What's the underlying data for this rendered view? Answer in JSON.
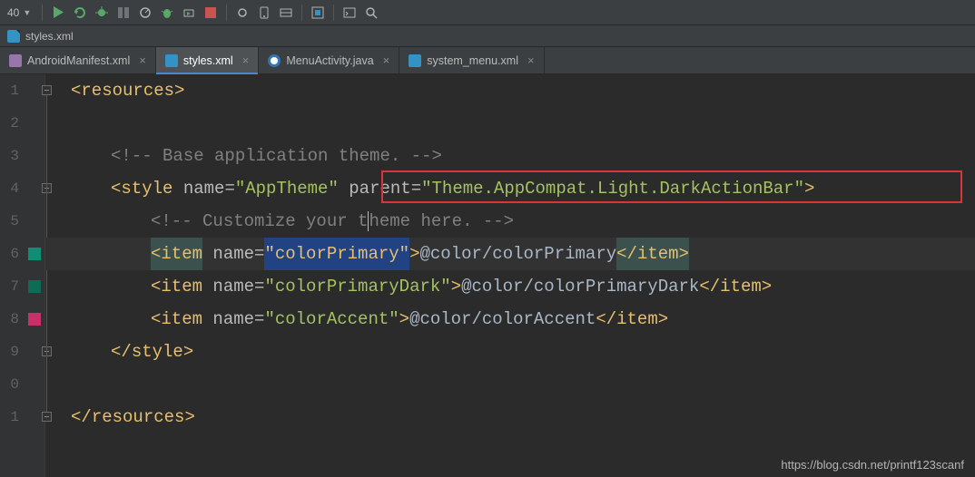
{
  "toolbar": {
    "run_config": "40",
    "icons": [
      "dropdown",
      "run",
      "debug",
      "coverage",
      "bug",
      "rerun",
      "profile",
      "stop",
      "attach",
      "layout1",
      "layout2",
      "settings",
      "device",
      "search"
    ]
  },
  "breadcrumb": {
    "file": "styles.xml"
  },
  "tabs": [
    {
      "label": "AndroidManifest.xml",
      "icon": "xml",
      "active": false
    },
    {
      "label": "styles.xml",
      "icon": "xml",
      "active": true
    },
    {
      "label": "MenuActivity.java",
      "icon": "java",
      "active": false
    },
    {
      "label": "system_menu.xml",
      "icon": "xml",
      "active": false
    }
  ],
  "gutter": {
    "lines": [
      "1",
      "2",
      "3",
      "4",
      "5",
      "6",
      "7",
      "8",
      "9",
      "0",
      "1"
    ],
    "squares": [
      {
        "line": 6,
        "color": "#0e8f73"
      },
      {
        "line": 7,
        "color": "#0e6b55"
      },
      {
        "line": 8,
        "color": "#c9306a"
      }
    ],
    "bulb_line": 6
  },
  "code": {
    "l1": {
      "open": "<",
      "tag": "resources",
      "close": ">"
    },
    "l3": {
      "comment": "<!-- Base application theme. -->"
    },
    "l4": {
      "open": "<",
      "tag": "style",
      "a1": "name",
      "v1": "\"AppTheme\"",
      "a2": "parent",
      "v2": "\"Theme.AppCompat.Light.DarkActionBar\"",
      "close": ">"
    },
    "l5": {
      "comment": "<!-- Customize your theme here. -->"
    },
    "l6": {
      "open": "<",
      "tag": "item",
      "a1": "name",
      "v1": "\"colorPrimary\"",
      "mid": ">",
      "text": "@color/colorPrimary",
      "end_open": "</",
      "end_tag": "item",
      "end_close": ">"
    },
    "l7": {
      "open": "<",
      "tag": "item",
      "a1": "name",
      "v1": "\"colorPrimaryDark\"",
      "mid": ">",
      "text": "@color/colorPrimaryDark",
      "end_open": "</",
      "end_tag": "item",
      "end_close": ">"
    },
    "l8": {
      "open": "<",
      "tag": "item",
      "a1": "name",
      "v1": "\"colorAccent\"",
      "mid": ">",
      "text": "@color/colorAccent",
      "end_open": "</",
      "end_tag": "item",
      "end_close": ">"
    },
    "l9": {
      "open": "</",
      "tag": "style",
      "close": ">"
    },
    "l11": {
      "open": "</",
      "tag": "resources",
      "close": ">"
    }
  },
  "watermark": "https://blog.csdn.net/printf123scanf"
}
